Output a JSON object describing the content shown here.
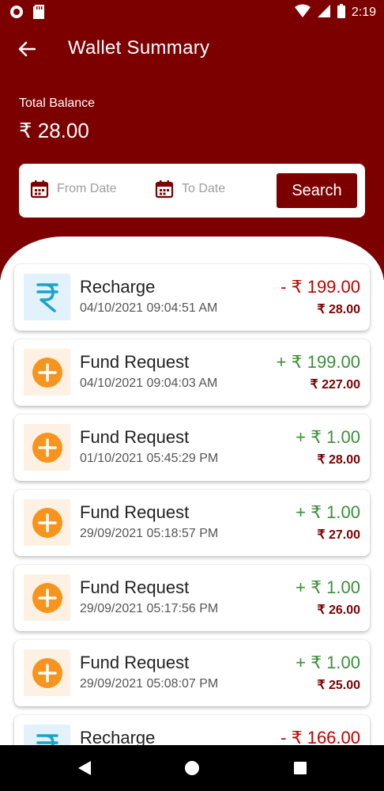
{
  "status_bar": {
    "time": "2:19"
  },
  "app_bar": {
    "title": "Wallet Summary"
  },
  "balance": {
    "label": "Total Balance",
    "value": "₹ 28.00"
  },
  "filter": {
    "from_placeholder": "From Date",
    "to_placeholder": "To Date",
    "search_label": "Search"
  },
  "transactions": [
    {
      "title": "Recharge",
      "datetime": "04/10/2021 09:04:51 AM",
      "amount": "- ₹ 199.00",
      "balance": "₹ 28.00",
      "type": "debit",
      "icon": "rupee-icon"
    },
    {
      "title": "Fund Request",
      "datetime": "04/10/2021 09:04:03 AM",
      "amount": "+ ₹ 199.00",
      "balance": "₹ 227.00",
      "type": "credit",
      "icon": "plus-circle-icon"
    },
    {
      "title": "Fund Request",
      "datetime": "01/10/2021 05:45:29 PM",
      "amount": "+ ₹ 1.00",
      "balance": "₹ 28.00",
      "type": "credit",
      "icon": "plus-circle-icon"
    },
    {
      "title": "Fund Request",
      "datetime": "29/09/2021 05:18:57 PM",
      "amount": "+ ₹ 1.00",
      "balance": "₹ 27.00",
      "type": "credit",
      "icon": "plus-circle-icon"
    },
    {
      "title": "Fund Request",
      "datetime": "29/09/2021 05:17:56 PM",
      "amount": "+ ₹ 1.00",
      "balance": "₹ 26.00",
      "type": "credit",
      "icon": "plus-circle-icon"
    },
    {
      "title": "Fund Request",
      "datetime": "29/09/2021 05:08:07 PM",
      "amount": "+ ₹ 1.00",
      "balance": "₹ 25.00",
      "type": "credit",
      "icon": "plus-circle-icon"
    },
    {
      "title": "Recharge",
      "datetime": "",
      "amount": "- ₹ 166.00",
      "balance": "",
      "type": "debit",
      "icon": "rupee-icon"
    }
  ],
  "colors": {
    "primary": "#7d0000",
    "debit": "#c00000",
    "credit": "#3a8f3a",
    "rupee_icon": "#1aa3c9",
    "plus_icon": "#f7941d"
  }
}
